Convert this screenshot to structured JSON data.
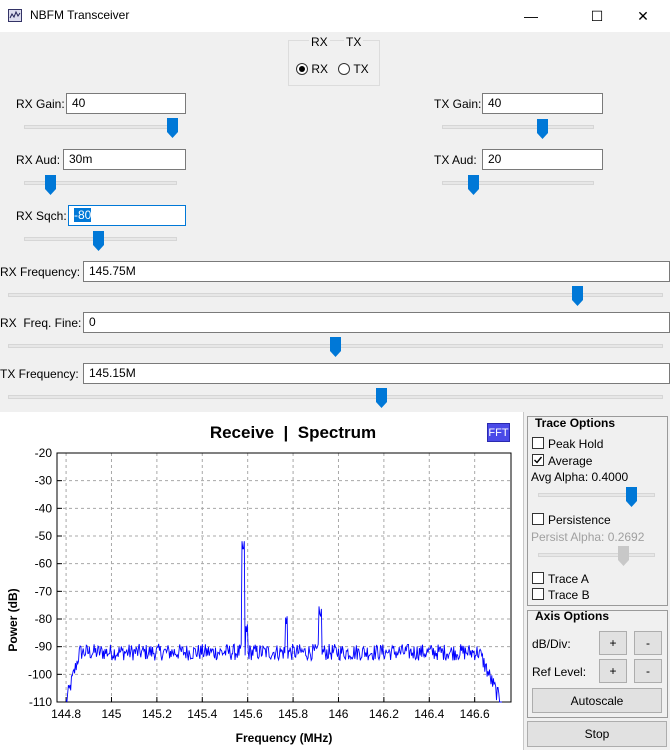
{
  "window": {
    "title": "NBFM Transceiver",
    "minimize": "—",
    "maximize": "☐",
    "close": "✕"
  },
  "mode": {
    "header_rx": "RX",
    "header_tx": "TX",
    "rx_label": "RX",
    "tx_label": "TX",
    "selected": "RX"
  },
  "rx_gain": {
    "label": "RX Gain:",
    "value": "40",
    "slider": 0.97
  },
  "rx_aud": {
    "label": "RX Aud:",
    "value": "30m",
    "slider": 0.17
  },
  "rx_sqch": {
    "label": "RX Sqch:",
    "value": "-80",
    "slider": 0.49
  },
  "tx_gain": {
    "label": "TX Gain:",
    "value": "40",
    "slider": 0.66
  },
  "tx_aud": {
    "label": "TX Aud:",
    "value": "20",
    "slider": 0.21
  },
  "rx_freq": {
    "label": "RX Frequency:",
    "value": "145.75M",
    "slider": 0.87
  },
  "rx_fine": {
    "label": "RX  Freq. Fine:",
    "value": "0",
    "slider": 0.5
  },
  "tx_freq": {
    "label": "TX Frequency:",
    "value": "145.15M",
    "slider": 0.57
  },
  "trace_options": {
    "title": "Trace Options",
    "peak_hold": {
      "label": "Peak Hold",
      "checked": false
    },
    "average": {
      "label": "Average",
      "checked": true
    },
    "avg_alpha": {
      "label": "Avg Alpha: 0.4000",
      "slider": 0.8
    },
    "persistence": {
      "label": "Persistence",
      "checked": false
    },
    "persist_alpha": {
      "label": "Persist Alpha: 0.2692",
      "slider": 0.73
    },
    "trace_a": {
      "label": "Trace A",
      "checked": false
    },
    "trace_b": {
      "label": "Trace B",
      "checked": false
    }
  },
  "axis_options": {
    "title": "Axis Options",
    "db_div": "dB/Div:",
    "ref_level": "Ref Level:",
    "plus": "+",
    "minus": "-",
    "autoscale": "Autoscale"
  },
  "stop_label": "Stop",
  "fft_badge": "FFT",
  "colors": {
    "trace": "#0000ff",
    "accent": "#0078d7",
    "fft_badge": "#4a4ae8"
  },
  "chart_data": {
    "type": "line",
    "title": "Receive  |  Spectrum",
    "xlabel": "Frequency (MHz)",
    "ylabel": "Power (dB)",
    "xlim": [
      144.76,
      146.76
    ],
    "ylim": [
      -110,
      -20
    ],
    "xticks": [
      144.8,
      145,
      145.2,
      145.4,
      145.6,
      145.8,
      146,
      146.2,
      146.4,
      146.6
    ],
    "xtick_labels": [
      "144.8",
      "145",
      "145.2",
      "145.4",
      "145.6",
      "145.8",
      "146",
      "146.2",
      "146.4",
      "146.6"
    ],
    "yticks": [
      -20,
      -30,
      -40,
      -50,
      -60,
      -70,
      -80,
      -90,
      -100,
      -110
    ],
    "ytick_labels": [
      "-20",
      "-30",
      "-40",
      "-50",
      "-60",
      "-70",
      "-80",
      "-90",
      "-100",
      "-110"
    ],
    "grid": true,
    "series": [
      {
        "noise_floor": -92,
        "x_start": 144.8,
        "x_end": 146.72,
        "peaks": [
          {
            "x": 145.58,
            "y": -56
          },
          {
            "x": 145.77,
            "y": -82
          },
          {
            "x": 145.92,
            "y": -80
          },
          {
            "x": 145.595,
            "y": -85
          }
        ]
      }
    ]
  }
}
